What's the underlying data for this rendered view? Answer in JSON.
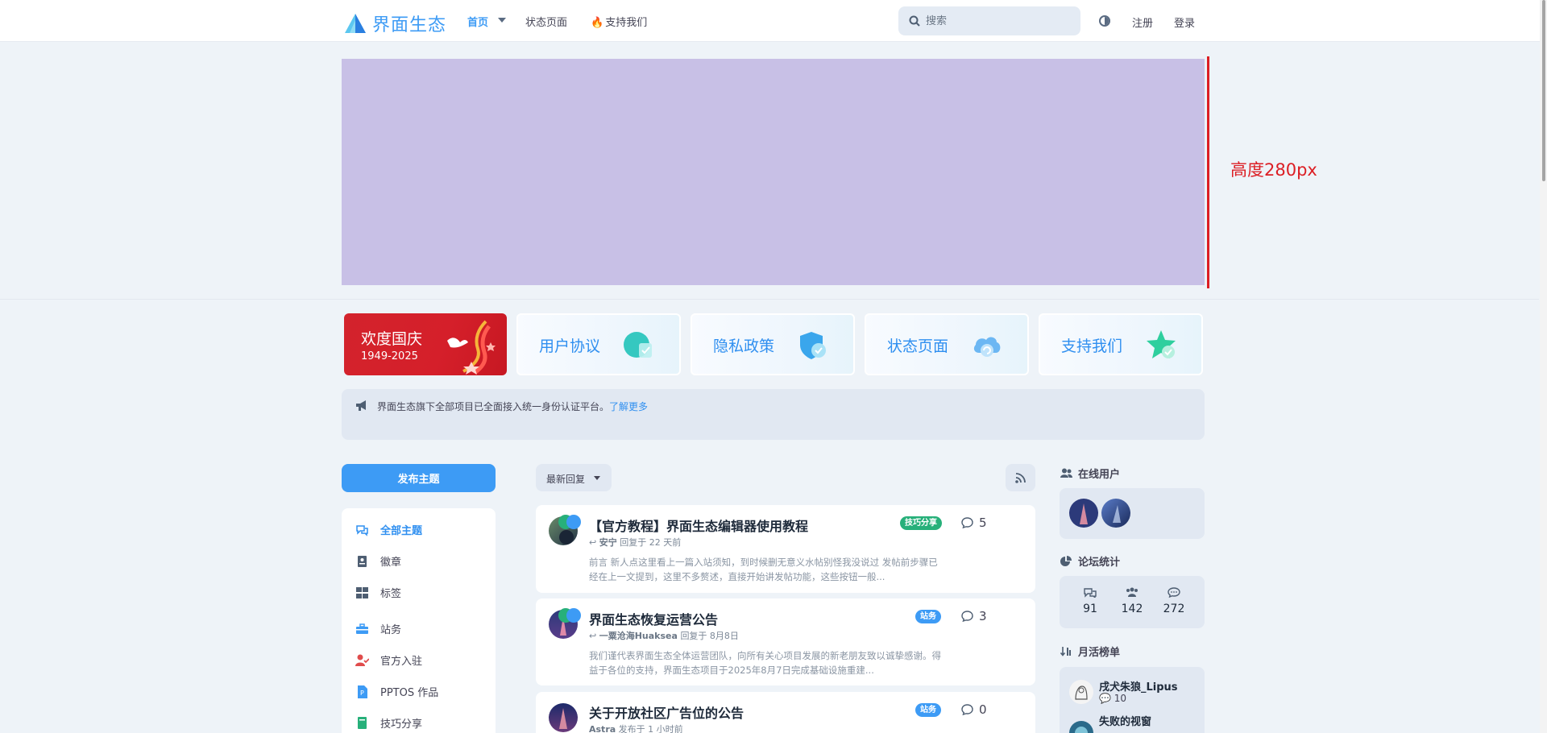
{
  "header": {
    "logo_text": "界面生态",
    "nav": {
      "home": "首页",
      "status": "状态页面",
      "support": "支持我们"
    },
    "search_placeholder": "搜索",
    "register": "注册",
    "login": "登录"
  },
  "banner": {
    "height_label": "高度280px"
  },
  "cards": {
    "national_day": {
      "title": "欢度国庆",
      "years": "1949-2025"
    },
    "items": [
      {
        "label": "用户协议"
      },
      {
        "label": "隐私政策"
      },
      {
        "label": "状态页面"
      },
      {
        "label": "支持我们"
      }
    ]
  },
  "notice": {
    "text": "界面生态旗下全部项目已全面接入统一身份认证平台。",
    "link": "了解更多"
  },
  "sidebar": {
    "new_topic": "发布主题",
    "items": [
      {
        "label": "全部主题",
        "icon": "discussions-icon",
        "active": true
      },
      {
        "label": "徽章",
        "icon": "badge-icon"
      },
      {
        "label": "标签",
        "icon": "tags-icon"
      },
      {
        "label": "站务",
        "icon": "toolbox-icon"
      },
      {
        "label": "官方入驻",
        "icon": "user-check-icon"
      },
      {
        "label": "PPTOS 作品",
        "icon": "ppt-file-icon"
      },
      {
        "label": "技巧分享",
        "icon": "book-icon"
      }
    ]
  },
  "feed": {
    "sort_label": "最新回复",
    "posts": [
      {
        "title": "【官方教程】界面生态编辑器使用教程",
        "user": "安宁",
        "meta": "回复于 22 天前",
        "excerpt": "前言 新人点这里看上一篇入站须知，到时候删无意义水帖别怪我没说过 发帖前步骤已经在上一文提到，这里不多赘述，直接开始讲发帖功能，这些按钮一般...",
        "tag": "技巧分享",
        "replies": "5"
      },
      {
        "title": "界面生态恢复运营公告",
        "user": "一粟沧海Huaksea",
        "meta": "回复于 8月8日",
        "excerpt": "我们谨代表界面生态全体运营团队，向所有关心项目发展的新老朋友致以诚挚感谢。得益于各位的支持，界面生态项目于2025年8月7日完成基础设施重建...",
        "tag": "站务",
        "replies": "3"
      },
      {
        "title": "关于开放社区广告位的公告",
        "user": "Astra",
        "meta": "发布于 1 小时前",
        "excerpt": "",
        "tag": "站务",
        "replies": "0"
      }
    ]
  },
  "right": {
    "online_title": "在线用户",
    "stats_title": "论坛统计",
    "stats": {
      "discussions": "91",
      "users": "142",
      "posts": "272"
    },
    "rank_title": "月活榜单",
    "ranks": [
      {
        "name": "戌犬朱狼_Lipus",
        "count": "10"
      },
      {
        "name": "失败的视窗",
        "count": ""
      }
    ]
  },
  "colors": {
    "accent": "#3d9bf5",
    "banner": "#c8c0e6",
    "rule": "#dc1e24",
    "tag_green": "#27b07a"
  }
}
